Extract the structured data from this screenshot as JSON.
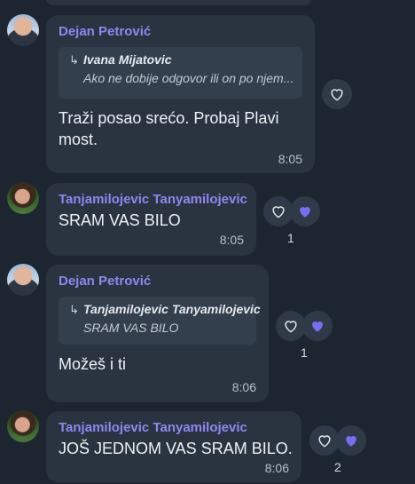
{
  "messages": [
    {
      "sender": "Dejan Petrović",
      "reply_author": "Ivana Mijatovic",
      "reply_text": "Ako ne dobije odgovor ili on po njem...",
      "text_line1": "Traži posao srećo. Probaj Plavi",
      "text_line2": "most.",
      "time": "8:05",
      "reactions": {
        "like_icon": "heart-outline-icon",
        "count": ""
      }
    },
    {
      "sender": "Tanjamilojevic Tanyamilojevic",
      "text": "SRAM VAS BILO",
      "time": "8:05",
      "reactions": {
        "like_icon": "heart-outline-icon",
        "loved_icon": "heart-filled-icon",
        "count": "1"
      }
    },
    {
      "sender": "Dejan Petrović",
      "reply_author": "Tanjamilojevic Tanyamilojevic",
      "reply_text": "SRAM VAS BILO",
      "text": "Možeš i ti",
      "time": "8:06",
      "reactions": {
        "like_icon": "heart-outline-icon",
        "loved_icon": "heart-filled-icon",
        "count": "1"
      }
    },
    {
      "sender": "Tanjamilojevic Tanyamilojevic",
      "text": "JOŠ JEDNOM VAS SRAM BILO.",
      "time": "8:06",
      "reactions": {
        "like_icon": "heart-outline-icon",
        "loved_icon": "heart-filled-icon",
        "count": "2"
      }
    }
  ],
  "colors": {
    "background": "#1d2530",
    "bubble": "#2a3441",
    "sender_name": "#8f86f0",
    "heart_filled": "#7b6cf0"
  }
}
